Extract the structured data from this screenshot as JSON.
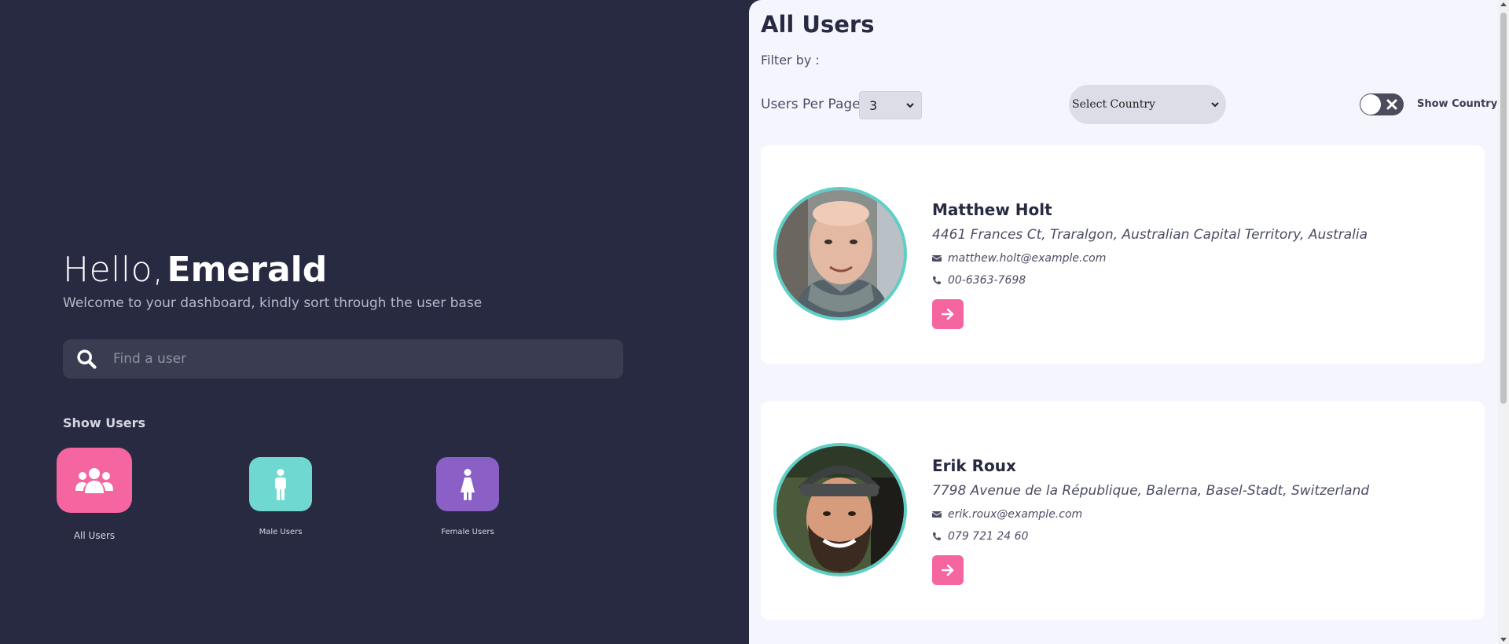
{
  "sidebar": {
    "greeting": "Hello,",
    "user_name": "Emerald",
    "welcome_text": "Welcome to your dashboard, kindly sort through the user base",
    "search": {
      "placeholder": "Find a user",
      "value": ""
    },
    "show_users_heading": "Show Users",
    "categories": [
      {
        "label": "All Users",
        "icon": "users-group-icon",
        "color": "#f5659f"
      },
      {
        "label": "Male Users",
        "icon": "male-icon",
        "color": "#6fd8d0"
      },
      {
        "label": "Female Users",
        "icon": "female-icon",
        "color": "#8b60c6"
      }
    ]
  },
  "main": {
    "title": "All Users",
    "filter_label": "Filter by :",
    "users_per_page_label": "Users Per Page",
    "users_per_page_value": "3",
    "country_select_value": "Select Country",
    "show_country_label": "Show Country",
    "show_country_toggle": false,
    "users": [
      {
        "name": "Matthew Holt",
        "address": "4461 Frances Ct, Traralgon, Australian Capital Territory, Australia",
        "email": "matthew.holt@example.com",
        "phone": "00-6363-7698"
      },
      {
        "name": "Erik Roux",
        "address": "7798 Avenue de la République, Balerna, Basel-Stadt, Switzerland",
        "email": "erik.roux@example.com",
        "phone": "079 721 24 60"
      }
    ]
  },
  "colors": {
    "sidebar_bg": "#272a41",
    "main_bg": "#f5f6fd",
    "accent_pink": "#f5659f",
    "accent_teal": "#6fd8d0",
    "accent_purple": "#8b60c6"
  }
}
